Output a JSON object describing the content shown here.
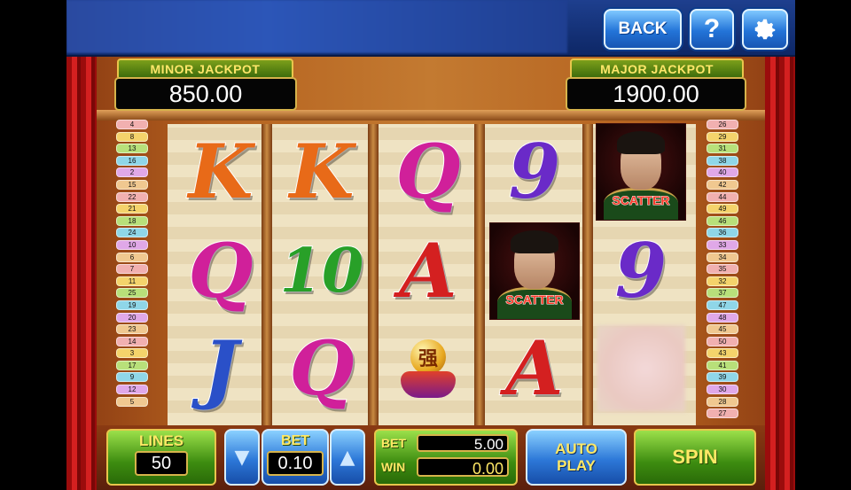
{
  "toolbar": {
    "back_label": "BACK",
    "help_label": "?",
    "settings_icon": "gear-icon"
  },
  "jackpots": {
    "minor": {
      "label": "MINOR JACKPOT",
      "value": "850.00"
    },
    "major": {
      "label": "MAJOR JACKPOT",
      "value": "1900.00"
    }
  },
  "lines_left": [
    "4",
    "8",
    "13",
    "16",
    "2",
    "15",
    "22",
    "21",
    "18",
    "24",
    "10",
    "6",
    "7",
    "11",
    "25",
    "19",
    "20",
    "23",
    "14",
    "3",
    "17",
    "9",
    "12",
    "5"
  ],
  "lines_right": [
    "26",
    "29",
    "31",
    "38",
    "40",
    "42",
    "44",
    "49",
    "46",
    "36",
    "33",
    "34",
    "35",
    "32",
    "37",
    "47",
    "48",
    "45",
    "50",
    "43",
    "41",
    "39",
    "30",
    "28",
    "27"
  ],
  "reels": [
    [
      {
        "t": "K",
        "c": "#e86a18"
      },
      {
        "t": "K",
        "c": "#e86a18"
      },
      {
        "t": "Q",
        "c": "#d0209a"
      },
      {
        "t": "9",
        "c": "#6a2ac8"
      },
      {
        "t": "SCATTER",
        "c": ""
      }
    ],
    [
      {
        "t": "Q",
        "c": "#d0209a"
      },
      {
        "t": "10",
        "c": "#28a028"
      },
      {
        "t": "A",
        "c": "#d42020"
      },
      {
        "t": "SCATTER",
        "c": ""
      },
      {
        "t": "9",
        "c": "#6a2ac8"
      }
    ],
    [
      {
        "t": "J",
        "c": "#2a50c8"
      },
      {
        "t": "Q",
        "c": "#d0209a"
      },
      {
        "t": "BALL",
        "c": ""
      },
      {
        "t": "A",
        "c": "#d42020"
      },
      {
        "t": "BLUR",
        "c": ""
      }
    ]
  ],
  "scatter_text": "SCATTER",
  "ball_glyph": "强",
  "controls": {
    "lines_label": "LINES",
    "lines_value": "50",
    "bet_label": "BET",
    "bet_value": "0.10",
    "total_bet_label": "BET",
    "total_bet_value": "5.00",
    "win_label": "WIN",
    "win_value": "0.00",
    "auto_play_label": "AUTO PLAY",
    "spin_label": "SPIN",
    "down_arrow": "▼",
    "up_arrow": "▲"
  },
  "colors": {
    "gold": "#e8c64b",
    "green": "#3d8c10",
    "blue": "#2d78d8",
    "curtain": "#c41818"
  }
}
